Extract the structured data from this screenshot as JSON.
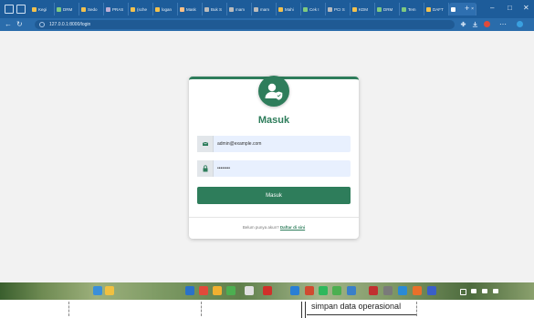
{
  "browser": {
    "tabs": [
      {
        "label": "Kegi",
        "color": "#f2c14e"
      },
      {
        "label": "DRM",
        "color": "#7fc97f"
      },
      {
        "label": "Sedo",
        "color": "#f2c14e"
      },
      {
        "label": "PRAS",
        "color": "#beaed4"
      },
      {
        "label": "(sche",
        "color": "#f2c14e"
      },
      {
        "label": "logan",
        "color": "#f2c14e"
      },
      {
        "label": "Mask",
        "color": "#fdc086"
      },
      {
        "label": "Buk S",
        "color": "#bbbbbb"
      },
      {
        "label": "mam",
        "color": "#bbbbbb"
      },
      {
        "label": "mam",
        "color": "#bbbbbb"
      },
      {
        "label": "Mahi",
        "color": "#f2c14e"
      },
      {
        "label": "Cek I",
        "color": "#7fc97f"
      },
      {
        "label": "PCI S",
        "color": "#bbbbbb"
      },
      {
        "label": "KDM",
        "color": "#f2c14e"
      },
      {
        "label": "DRM",
        "color": "#7fc97f"
      },
      {
        "label": "Tem",
        "color": "#7fc97f"
      },
      {
        "label": "DAFT",
        "color": "#f2c14e"
      }
    ],
    "url": "127.0.0.1:8000/login"
  },
  "login": {
    "title": "Masuk",
    "email_value": "admin@example.com",
    "password_value": "••••••••",
    "submit_label": "Masuk",
    "footer_text": "Belum punya akun?",
    "register_link": "Daftar di sini"
  },
  "colors": {
    "primary": "#2e7d5b",
    "chrome": "#1d5c9a",
    "field_bg": "#e8f0fe"
  },
  "taskbar": {
    "apps": [
      {
        "name": "windows-icon",
        "color": "#3a8fd9"
      },
      {
        "name": "explorer-icon",
        "color": "#f0c040"
      },
      {
        "name": "mail-icon",
        "color": "#2a72c8"
      },
      {
        "name": "browser-icon",
        "color": "#e04a3a"
      },
      {
        "name": "folder-icon",
        "color": "#f0b030"
      },
      {
        "name": "chrome-icon",
        "color": "#4caf50"
      },
      {
        "name": "app-icon",
        "color": "#e0e0e0"
      },
      {
        "name": "pinterest-icon",
        "color": "#d0302a"
      },
      {
        "name": "vscode-icon",
        "color": "#2a7fd4"
      },
      {
        "name": "app2-icon",
        "color": "#d04a30"
      },
      {
        "name": "spotify-icon",
        "color": "#2eb85c"
      },
      {
        "name": "chrome2-icon",
        "color": "#4caf50"
      },
      {
        "name": "terminal-icon",
        "color": "#3a7fc8"
      },
      {
        "name": "word-icon",
        "color": "#c03030"
      },
      {
        "name": "settings-icon",
        "color": "#7a7a7a"
      },
      {
        "name": "edge-icon",
        "color": "#2a8ad4"
      },
      {
        "name": "office-icon",
        "color": "#e8702a"
      },
      {
        "name": "app3-icon",
        "color": "#3a5fc8"
      }
    ]
  },
  "annotation": "simpan data operasional"
}
